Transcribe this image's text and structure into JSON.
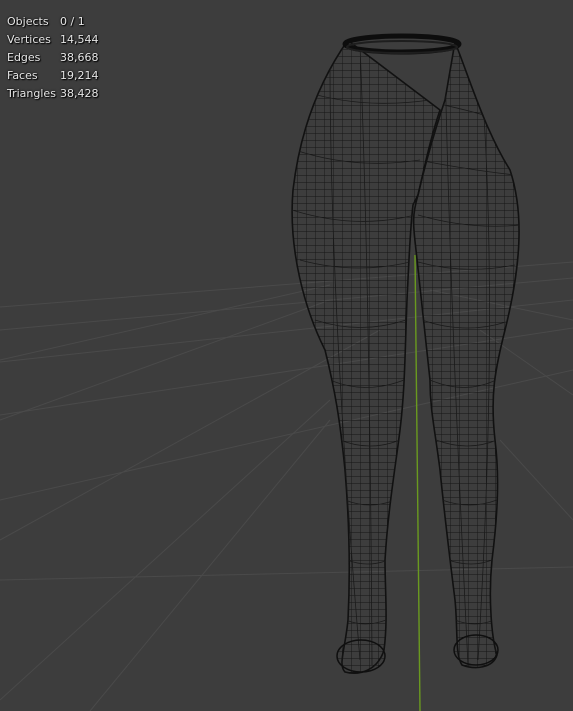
{
  "overlay": {
    "stats": [
      {
        "label": "Objects",
        "value": "0 / 1"
      },
      {
        "label": "Vertices",
        "value": "14,544"
      },
      {
        "label": "Edges",
        "value": "38,668"
      },
      {
        "label": "Faces",
        "value": "19,214"
      },
      {
        "label": "Triangles",
        "value": "38,428"
      }
    ]
  },
  "scene": {
    "background_color": "#3d3d3d",
    "grid_color": "#4a4a4a",
    "y_axis_color": "#6a9a1f",
    "wire_color": "#141414",
    "object": "wireframe-mesh-legs",
    "shading": "wireframe"
  }
}
